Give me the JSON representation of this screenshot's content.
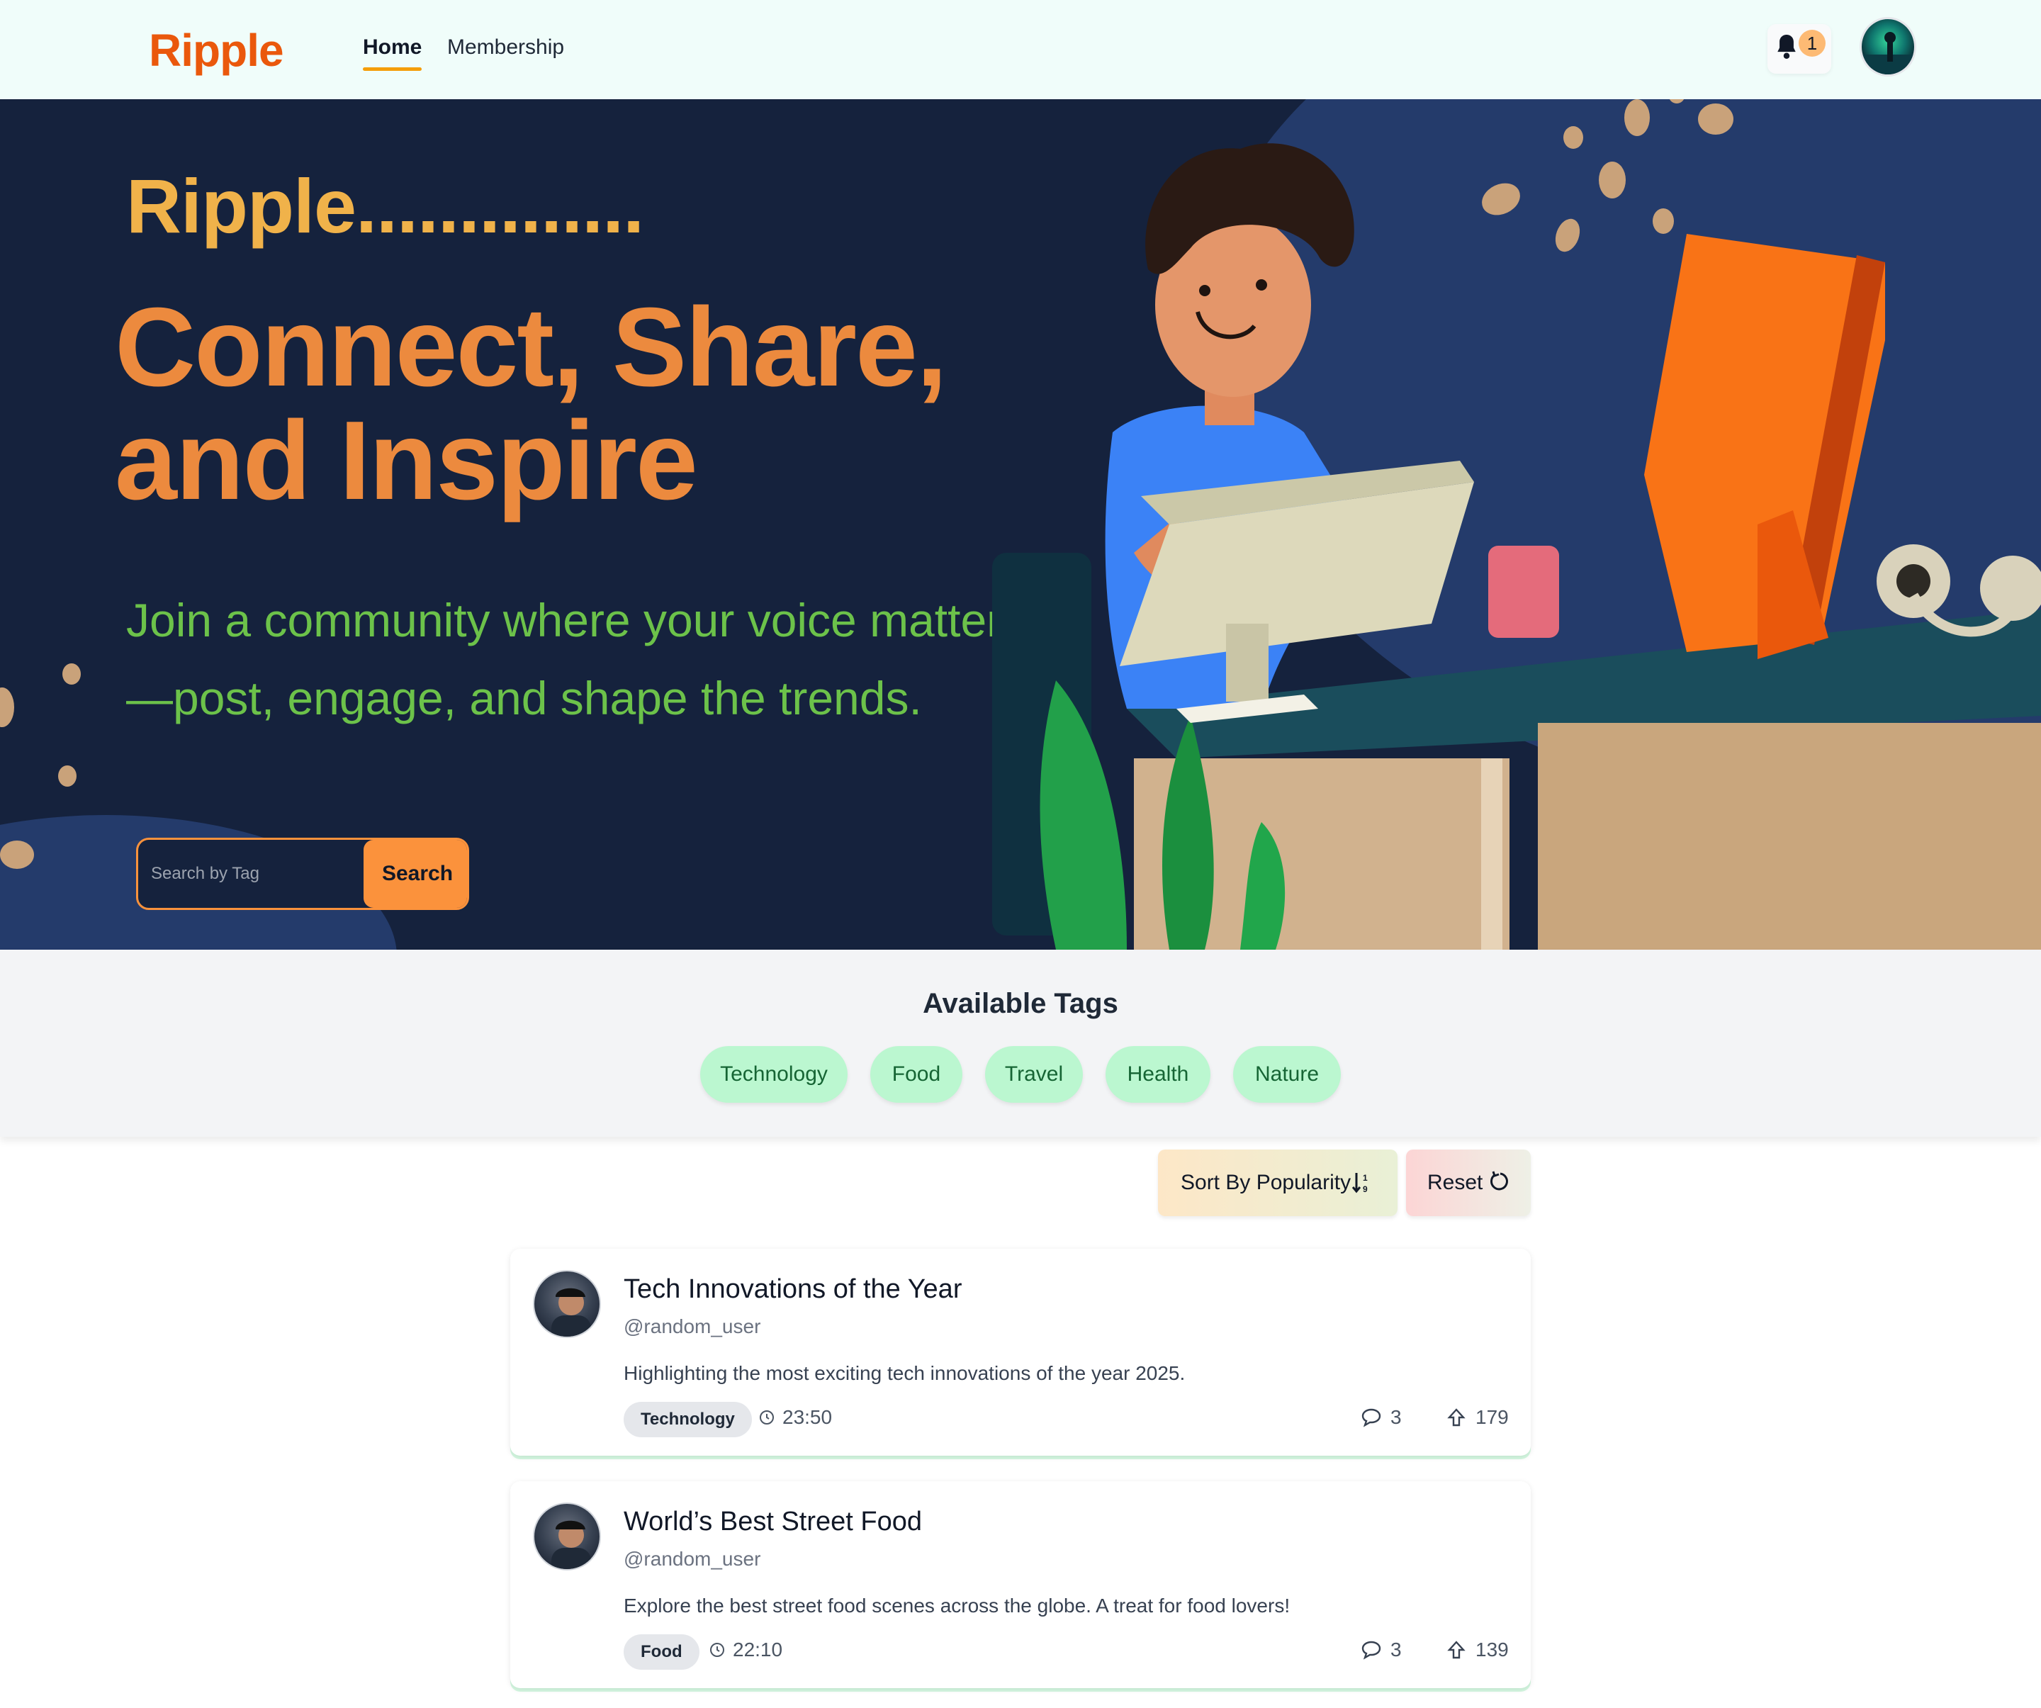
{
  "nav": {
    "logo": "Ripple",
    "links": [
      "Home",
      "Membership"
    ],
    "notification_count": "1"
  },
  "hero": {
    "brand": "Ripple..............",
    "title": "Connect, Share, and Inspire",
    "subtitle": "Join a community where your voice matters—post, engage, and shape the trends.",
    "search_placeholder": "Search by Tag",
    "search_button": "Search"
  },
  "tags": {
    "title": "Available Tags",
    "items": [
      "Technology",
      "Food",
      "Travel",
      "Health",
      "Nature"
    ]
  },
  "controls": {
    "sort_label": "Sort By Popularity",
    "reset_label": "Reset"
  },
  "posts": [
    {
      "title": "Tech Innovations of the Year",
      "user": "@random_user",
      "body": "Highlighting the most exciting tech innovations of the year 2025.",
      "tag": "Technology",
      "time": "23:50",
      "comments": "3",
      "votes": "179"
    },
    {
      "title": "World’s Best Street Food",
      "user": "@random_user",
      "body": "Explore the best street food scenes across the globe. A treat for food lovers!",
      "tag": "Food",
      "time": "22:10",
      "comments": "3",
      "votes": "139"
    }
  ],
  "colors": {
    "brand_orange": "#ea580c",
    "hero_bg": "#15223d",
    "hero_green": "#6cc24a",
    "tag_green": "#bbf7d0"
  }
}
